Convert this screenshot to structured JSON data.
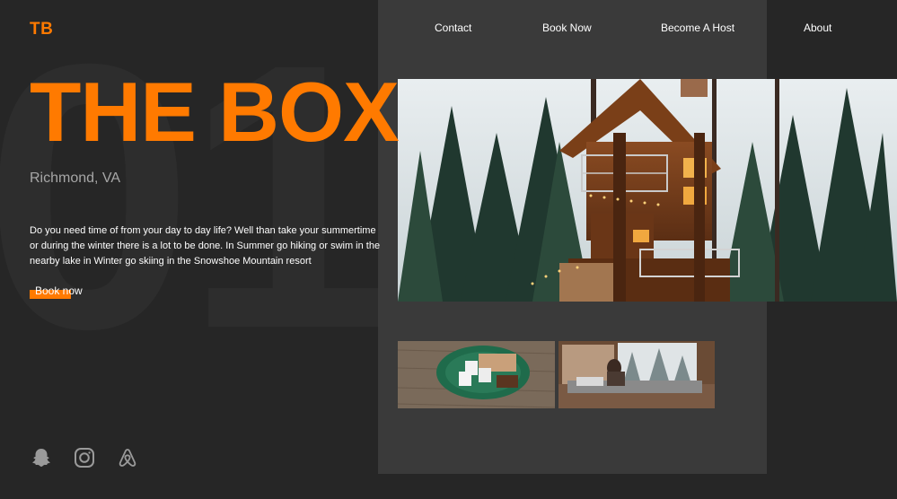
{
  "brand": {
    "logo_text": "TB",
    "accent_color": "#ff7a00",
    "background_number": "01"
  },
  "nav": {
    "items": [
      {
        "label": "Contact"
      },
      {
        "label": "Book Now"
      },
      {
        "label": "Become A Host"
      },
      {
        "label": "About"
      }
    ]
  },
  "hero": {
    "title": "THE BOX",
    "location": "Richmond, VA",
    "description": "Do you need time of from your day to day life? Well than take your summertime or during the winter there is a lot to be done. In Summer go hiking or swim in the nearby lake in Winter go skiing in the Snowshoe Mountain resort",
    "cta_label": "Book now"
  },
  "images": {
    "hero": "treehouse-cabin-in-pine-forest",
    "thumbs": [
      "smores-plate-on-wooden-table",
      "cozy-bed-by-snowy-window"
    ]
  },
  "social": {
    "icons": [
      "snapchat-icon",
      "instagram-icon",
      "airbnb-icon"
    ]
  }
}
